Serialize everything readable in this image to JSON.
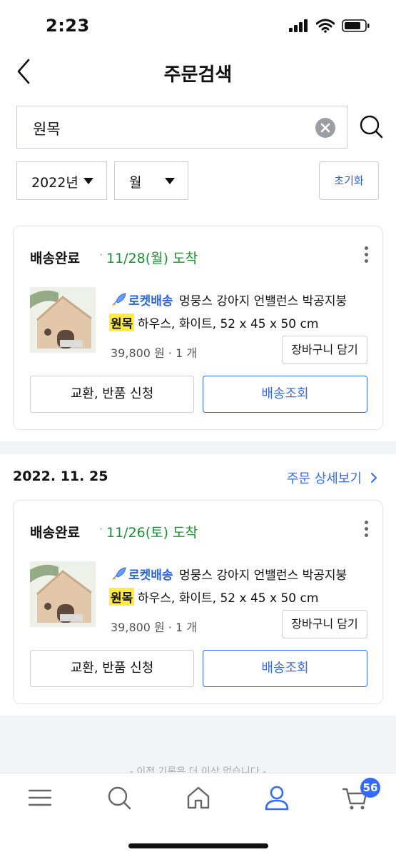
{
  "status_bar": {
    "time": "2:23"
  },
  "header": {
    "title": "주문검색"
  },
  "search": {
    "value": "원목"
  },
  "filters": {
    "year": "2022년",
    "month": "월",
    "reset_label": "초기화"
  },
  "orders": [
    {
      "status": "배송완료",
      "dot": "·",
      "arrival": "11/28(월) 도착",
      "rocket_label": "로켓배송",
      "name_line1": "멍뭉스 강아지 언밸런스 박공지붕",
      "highlight": "원목",
      "name_line2": "하우스, 화이트, 52 x 45 x 50 cm",
      "price": "39,800 원 · 1 개",
      "cart_label": "장바구니 담기",
      "exchange_label": "교환, 반품 신청",
      "track_label": "배송조회"
    },
    {
      "order_date": "2022. 11. 25",
      "detail_label": "주문 상세보기",
      "status": "배송완료",
      "dot": "·",
      "arrival": "11/26(토) 도착",
      "rocket_label": "로켓배송",
      "name_line1": "멍뭉스 강아지 언밸런스 박공지붕",
      "highlight": "원목",
      "name_line2": "하우스, 화이트, 52 x 45 x 50 cm",
      "price": "39,800 원 · 1 개",
      "cart_label": "장바구니 담기",
      "exchange_label": "교환, 반품 신청",
      "track_label": "배송조회"
    }
  ],
  "footer_faded": "- 이전 기록은 더 이상 없습니다 -",
  "tabbar": {
    "cart_badge": "56"
  },
  "colors": {
    "accent": "#346aff",
    "arrive_green": "#1d8f36",
    "highlight": "#ffec3d"
  }
}
